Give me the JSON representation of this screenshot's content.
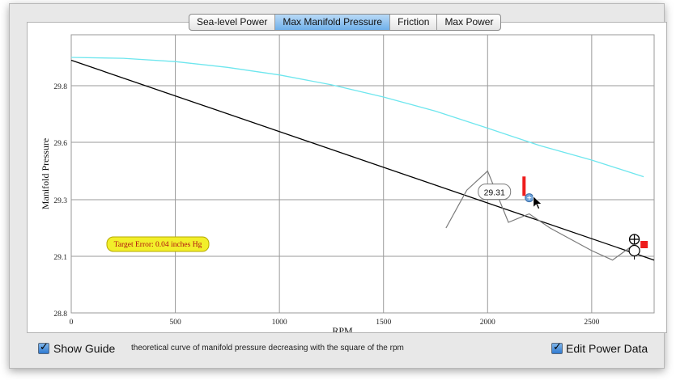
{
  "tabs": [
    "Sea-level Power",
    "Max Manifold Pressure",
    "Friction",
    "Max Power"
  ],
  "active_tab": 1,
  "bottom": {
    "show_guide_label": "Show Guide",
    "guide_description": "theoretical curve of manifold pressure decreasing with the square of the rpm",
    "edit_power_label": "Edit Power Data"
  },
  "tooltip": {
    "value": "29.31"
  },
  "target_error": {
    "text": "Target Error: 0.04 inches Hg"
  },
  "colors": {
    "accent": "#6fb0ea",
    "guide": "#6ee6ee",
    "handle": "#ee1c1c",
    "badge": "#f2ef2a"
  },
  "chart_data": {
    "type": "line",
    "xlabel": "RPM",
    "ylabel": "Manifold Pressure",
    "xlim": [
      0,
      2800
    ],
    "ylim": [
      28.8,
      30.3
    ],
    "xticks": [
      0,
      500,
      1000,
      1500,
      2000,
      2500
    ],
    "yticks": [
      28.8,
      29.1,
      29.3,
      29.6,
      29.8
    ],
    "ytick_labels": [
      "28.8",
      "29.1",
      "29.3",
      "29.6",
      "29.8"
    ],
    "xtick_labels": [
      "0",
      "500",
      "1000",
      "1500",
      "2000",
      "2500"
    ],
    "grid": true,
    "series": [
      {
        "type": "line",
        "color": "#000000",
        "x": [
          0,
          2800
        ],
        "y": [
          29.89,
          29.08
        ]
      },
      {
        "type": "curve",
        "color": "#6ee6ee",
        "x": [
          0,
          250,
          500,
          750,
          1000,
          1250,
          1500,
          1750,
          2000,
          2250,
          2500,
          2750
        ],
        "y": [
          29.9,
          29.897,
          29.885,
          29.865,
          29.838,
          29.803,
          29.76,
          29.71,
          29.65,
          29.583,
          29.507,
          29.42
        ]
      },
      {
        "type": "data",
        "color": "#7a7a7a",
        "x": [
          1800,
          1900,
          2000,
          2100,
          2200,
          2300,
          2400,
          2500,
          2600,
          2700
        ],
        "y": [
          29.2,
          29.35,
          29.45,
          29.22,
          29.25,
          29.2,
          29.16,
          29.12,
          29.08,
          29.14
        ]
      }
    ],
    "markers": [
      {
        "type": "selected-point",
        "x": 2200,
        "y": 29.31
      },
      {
        "type": "red-bar",
        "x": 2175,
        "y": 29.32
      },
      {
        "type": "red-square",
        "x": 2750,
        "y": 29.14
      },
      {
        "type": "crosshair",
        "x": 2705,
        "y": 29.16
      },
      {
        "type": "open-circle",
        "x": 2705,
        "y": 29.12
      }
    ]
  }
}
